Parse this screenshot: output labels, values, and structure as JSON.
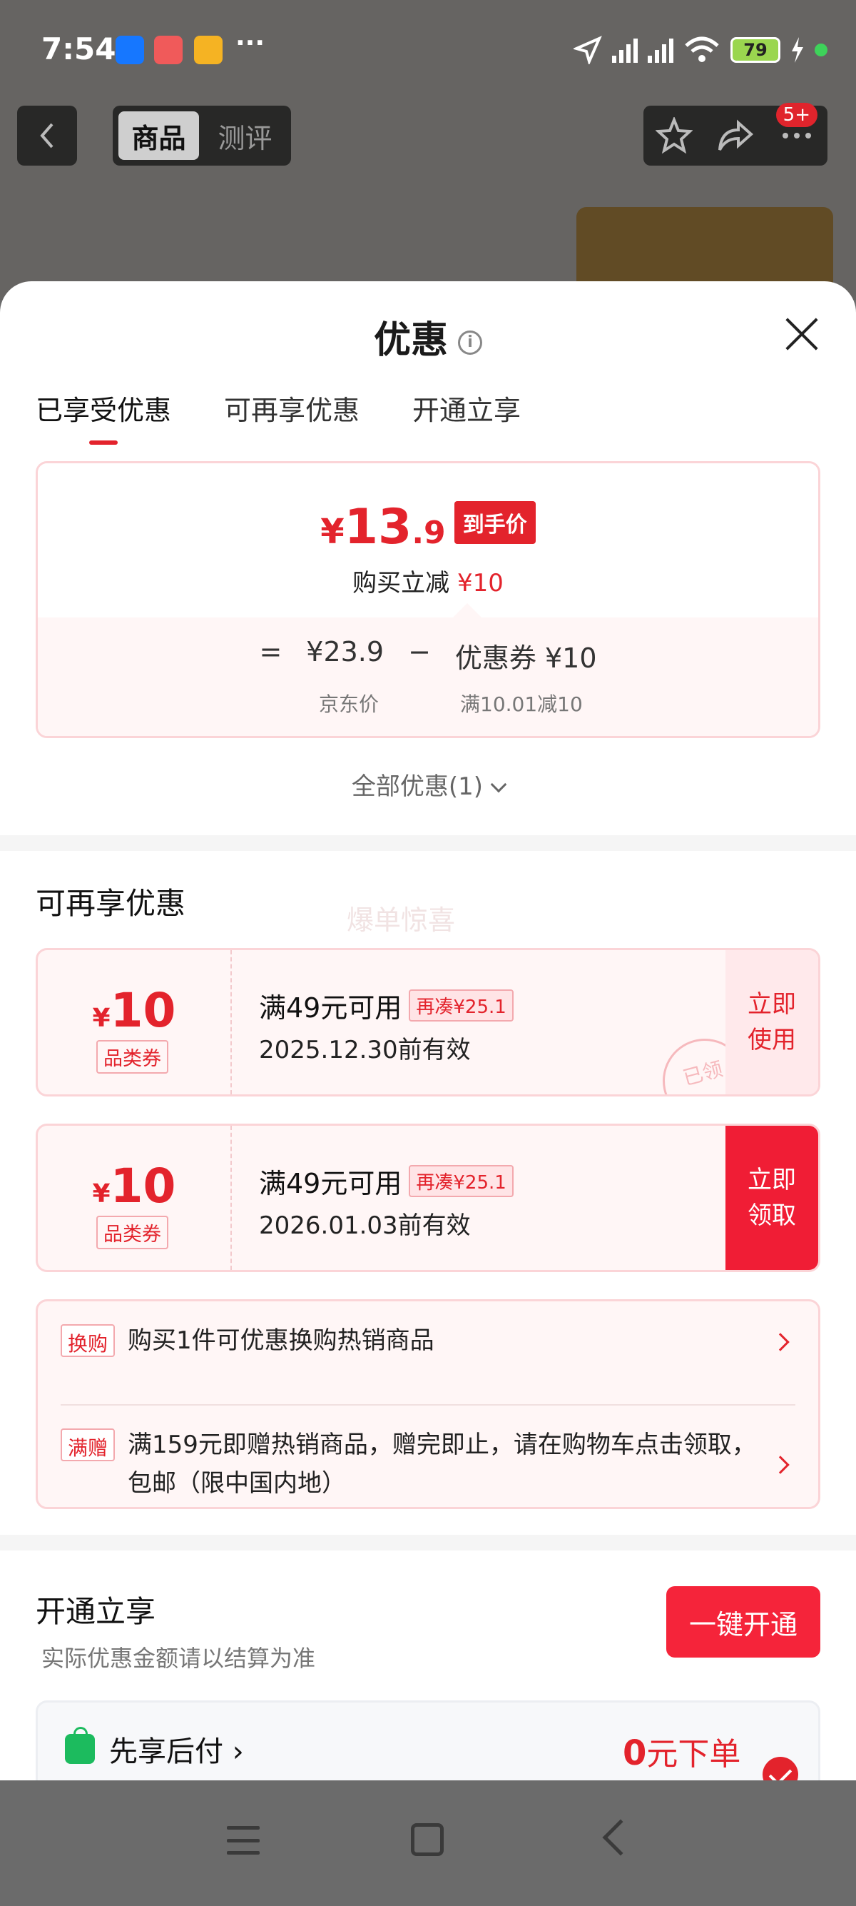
{
  "status_bar": {
    "time": "7:54",
    "more": "···",
    "battery": "79"
  },
  "nav": {
    "tabs": [
      "商品",
      "测评"
    ],
    "more_badge": "5+"
  },
  "sheet": {
    "title": "优惠",
    "tabs": [
      "已享受优惠",
      "可再享优惠",
      "开通立享"
    ],
    "price_card": {
      "currency": "¥",
      "price_int": "13",
      "price_dec": ".9",
      "price_tag": "到手价",
      "sub_text": "购买立减",
      "sub_amount": "¥10",
      "equals": "=",
      "jd_price": "¥23.9",
      "minus": "−",
      "coupon_text": "优惠券 ¥10",
      "jd_price_label": "京东价",
      "coupon_rule_label": "满10.01减10"
    },
    "all_discount": "全部优惠(1)",
    "more_section": {
      "title": "可再享优惠",
      "ghost": "爆单惊喜",
      "coupons": [
        {
          "currency": "¥",
          "amount": "10",
          "type": "品类券",
          "title": "满49元可用",
          "chip": "再凑¥25.1",
          "date": "2025.12.30前有效",
          "action": "立即使用",
          "stamp": "已领"
        },
        {
          "currency": "¥",
          "amount": "10",
          "type": "品类券",
          "title": "满49元可用",
          "chip": "再凑¥25.1",
          "date": "2026.01.03前有效",
          "action": "立即领取"
        }
      ],
      "promos": [
        {
          "tag": "换购",
          "text": "购买1件可优惠换购热销商品"
        },
        {
          "tag": "满赠",
          "text": "满159元即赠热销商品，赠完即止，请在购物车点击领取，包邮（限中国内地）"
        }
      ]
    },
    "open_section": {
      "title": "开通立享",
      "note": "实际优惠金额请以结算为准",
      "button": "一键开通",
      "pay_label": "先享后付 ›",
      "pay_amount": "0",
      "pay_suffix": "元下单"
    }
  },
  "colors": {
    "accent": "#e3232c",
    "soft_pink": "#fff6f6",
    "border_pink": "#fbd4d7",
    "green": "#1cbb5e"
  }
}
